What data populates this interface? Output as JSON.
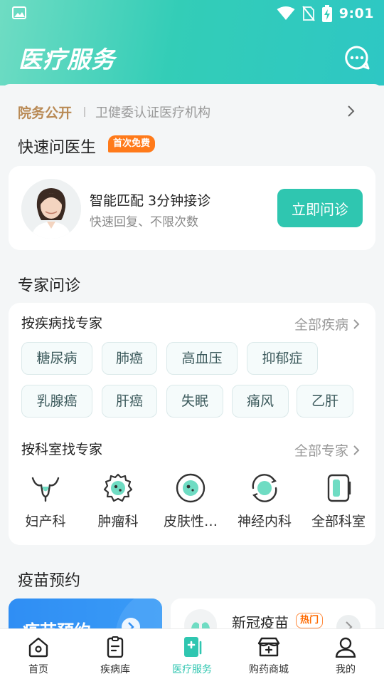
{
  "status": {
    "time": "9:01"
  },
  "header": {
    "title": "医疗服务"
  },
  "notice": {
    "tag": "院务公开",
    "text": "卫健委认证医疗机构"
  },
  "quick": {
    "title": "快速问医生",
    "badge": "首次免费",
    "main_text": "智能匹配 3分钟接诊",
    "sub_text": "快速回复、不限次数",
    "button": "立即问诊"
  },
  "expert": {
    "title": "专家问诊",
    "by_disease": "按疾病找专家",
    "all_disease": "全部疾病",
    "diseases": [
      "糖尿病",
      "肺癌",
      "高血压",
      "抑郁症",
      "乳腺癌",
      "肝癌",
      "失眠",
      "痛风",
      "乙肝"
    ],
    "by_dept": "按科室找专家",
    "all_expert": "全部专家",
    "depts": [
      "妇产科",
      "肿瘤科",
      "皮肤性…",
      "神经内科",
      "全部科室"
    ]
  },
  "vaccine": {
    "title": "疫苗预约",
    "banner": "疫苗预约",
    "item_name": "新冠疫苗",
    "item_badge": "热门"
  },
  "tabs": [
    {
      "label": "首页",
      "icon": "home-icon"
    },
    {
      "label": "疾病库",
      "icon": "clipboard-icon"
    },
    {
      "label": "医疗服务",
      "icon": "medical-service-icon"
    },
    {
      "label": "购药商城",
      "icon": "pharmacy-store-icon"
    },
    {
      "label": "我的",
      "icon": "profile-icon"
    }
  ],
  "colors": {
    "accent": "#2fc6b0",
    "badge_orange": "#ff7a1a",
    "vaccine_blue": "#2f8ef4",
    "notice_gold": "#b98a55"
  }
}
